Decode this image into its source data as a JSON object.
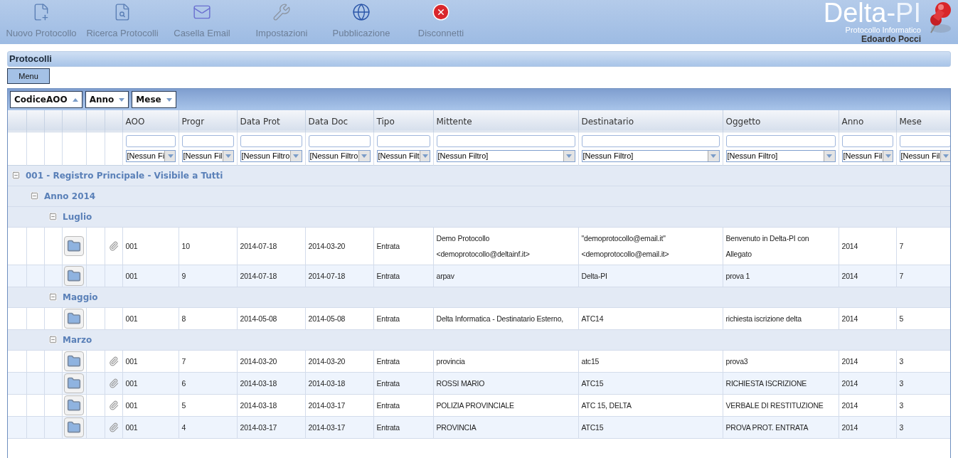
{
  "toolbar": [
    {
      "label": "Nuovo Protocollo",
      "kind": "new"
    },
    {
      "label": "Ricerca Protocolli",
      "kind": "search"
    },
    {
      "label": "Casella Email",
      "kind": "mail"
    },
    {
      "label": "Impostazioni",
      "kind": "settings"
    },
    {
      "label": "Pubblicazione",
      "kind": "web"
    },
    {
      "label": "Disconnetti",
      "kind": "logout"
    }
  ],
  "logo": {
    "name_main": "Delta-",
    "name_accent": "PI",
    "subtitle": "Protocollo Informatico",
    "user": "Edoardo Pocci"
  },
  "panel": {
    "title": "Protocolli",
    "menu_button": "Menu"
  },
  "grid": {
    "group_by": [
      {
        "label": "CodiceAOO",
        "ascending": true
      },
      {
        "label": "Anno",
        "ascending": false
      },
      {
        "label": "Mese",
        "ascending": false
      }
    ],
    "columns": [
      {
        "label": "AOO",
        "filter": "[Nessun Fi"
      },
      {
        "label": "Progr",
        "filter": "[Nessun Fil"
      },
      {
        "label": "Data Prot",
        "filter": "[Nessun Filtro"
      },
      {
        "label": "Data Doc",
        "filter": "[Nessun Filtro"
      },
      {
        "label": "Tipo",
        "filter": "[Nessun Filt"
      },
      {
        "label": "Mittente",
        "filter": "[Nessun Filtro]"
      },
      {
        "label": "Destinatario",
        "filter": "[Nessun Filtro]"
      },
      {
        "label": "Oggetto",
        "filter": "[Nessun Filtro]"
      },
      {
        "label": "Anno",
        "filter": "[Nessun Fil"
      },
      {
        "label": "Mese",
        "filter": "[Nessun Fil"
      }
    ],
    "groups": [
      {
        "label": "001 - Registro Principale - Visibile a Tutti",
        "expanded": true,
        "children": [
          {
            "label": "Anno 2014",
            "expanded": true,
            "children": [
              {
                "label": "Luglio",
                "expanded": true,
                "rows": [
                  {
                    "attachment": true,
                    "cells": [
                      "001",
                      "10",
                      "2014-07-18",
                      "2014-03-20",
                      "Entrata",
                      "Demo Protocollo <demoprotocollo@deltainf.it>",
                      "\"demoprotocollo@email.it\" <demoprotocollo@email.it>",
                      "Benvenuto in Delta-PI con Allegato",
                      "2014",
                      "7"
                    ]
                  },
                  {
                    "attachment": false,
                    "cells": [
                      "001",
                      "9",
                      "2014-07-18",
                      "2014-07-18",
                      "Entrata",
                      "arpav",
                      "Delta-PI",
                      "prova 1",
                      "2014",
                      "7"
                    ]
                  }
                ]
              },
              {
                "label": "Maggio",
                "expanded": true,
                "rows": [
                  {
                    "attachment": false,
                    "cells": [
                      "001",
                      "8",
                      "2014-05-08",
                      "2014-05-08",
                      "Entrata",
                      "Delta Informatica - Destinatario Esterno,",
                      "ATC14",
                      "richiesta iscrizione delta",
                      "2014",
                      "5"
                    ]
                  }
                ]
              },
              {
                "label": "Marzo",
                "expanded": true,
                "rows": [
                  {
                    "attachment": true,
                    "cells": [
                      "001",
                      "7",
                      "2014-03-20",
                      "2014-03-20",
                      "Entrata",
                      "provincia",
                      "atc15",
                      "prova3",
                      "2014",
                      "3"
                    ]
                  },
                  {
                    "attachment": true,
                    "cells": [
                      "001",
                      "6",
                      "2014-03-18",
                      "2014-03-18",
                      "Entrata",
                      "ROSSI MARIO",
                      "ATC15",
                      "RICHIESTA ISCRIZIONE",
                      "2014",
                      "3"
                    ]
                  },
                  {
                    "attachment": true,
                    "cells": [
                      "001",
                      "5",
                      "2014-03-18",
                      "2014-03-17",
                      "Entrata",
                      "POLIZIA PROVINCIALE",
                      "ATC 15, DELTA",
                      "VERBALE DI RESTITUZIONE",
                      "2014",
                      "3"
                    ]
                  },
                  {
                    "attachment": true,
                    "cells": [
                      "001",
                      "4",
                      "2014-03-17",
                      "2014-03-17",
                      "Entrata",
                      "PROVINCIA",
                      "ATC15",
                      "PROVA PROT. ENTRATA",
                      "2014",
                      "3"
                    ]
                  }
                ]
              }
            ]
          }
        ]
      }
    ]
  }
}
